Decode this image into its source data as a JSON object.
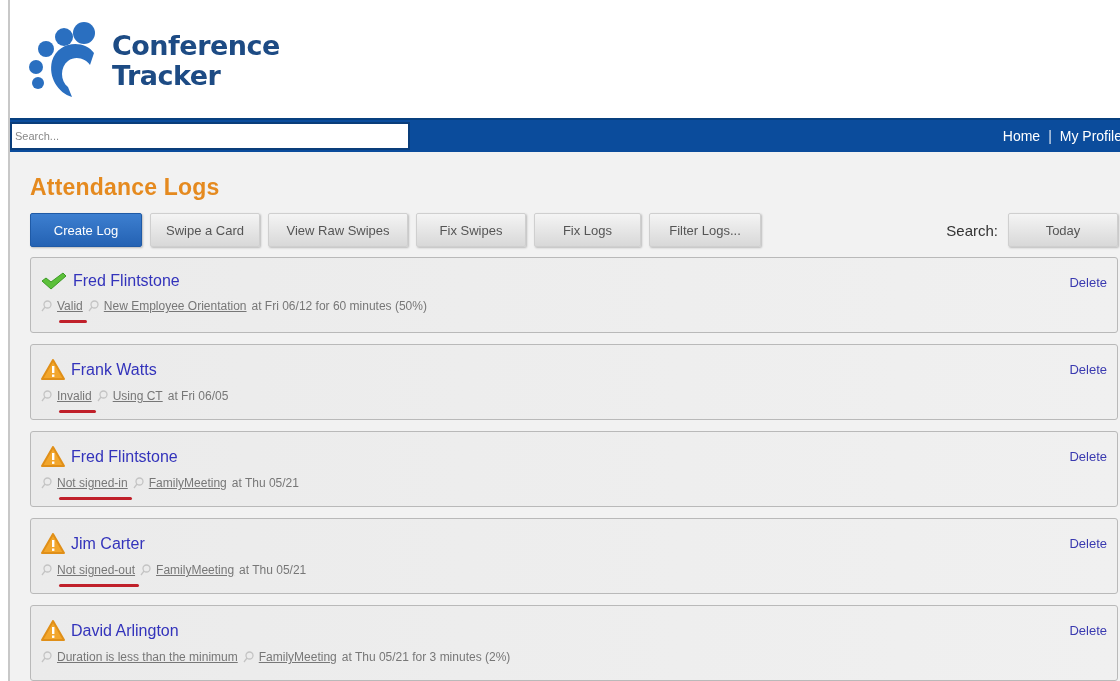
{
  "logo": {
    "line_1": "Conference",
    "line_2": "Tracker"
  },
  "nav": {
    "search": {
      "placeholder": "Search..."
    },
    "links": [
      "Home",
      "My Profile"
    ],
    "separator": "|"
  },
  "page_title": "Attendance Logs",
  "toolbar": {
    "buttons": [
      {
        "label": "Create Log",
        "primary": true
      },
      {
        "label": "Swipe a Card",
        "primary": false
      },
      {
        "label": "View Raw Swipes",
        "primary": false
      },
      {
        "label": "Fix Swipes",
        "primary": false
      },
      {
        "label": "Fix Logs",
        "primary": false
      },
      {
        "label": "Filter Logs...",
        "primary": false
      }
    ],
    "search_label": "Search:",
    "search_button": "Today"
  },
  "logs": [
    {
      "kind": "valid",
      "name": "Fred Flintstone",
      "status": "Valid",
      "event": "New Employee Orientation",
      "detail": "at Fri 06/12 for 60 minutes (50%)",
      "delete": "Delete",
      "highlighted": true
    },
    {
      "kind": "warning",
      "name": "Frank Watts",
      "status": "Invalid",
      "event": "Using CT",
      "detail": "at Fri 06/05",
      "delete": "Delete",
      "highlighted": true
    },
    {
      "kind": "warning",
      "name": "Fred Flintstone",
      "status": "Not signed-in",
      "event": "FamilyMeeting",
      "detail": "at Thu 05/21",
      "delete": "Delete",
      "highlighted": true
    },
    {
      "kind": "warning",
      "name": "Jim Carter",
      "status": "Not signed-out",
      "event": "FamilyMeeting",
      "detail": "at Thu 05/21",
      "delete": "Delete",
      "highlighted": true
    },
    {
      "kind": "warning",
      "name": "David Arlington",
      "status": "Duration is less than the minimum",
      "event": "FamilyMeeting",
      "detail": "at Thu 05/21 for 3 minutes (2%)",
      "delete": "Delete",
      "highlighted": false
    }
  ]
}
